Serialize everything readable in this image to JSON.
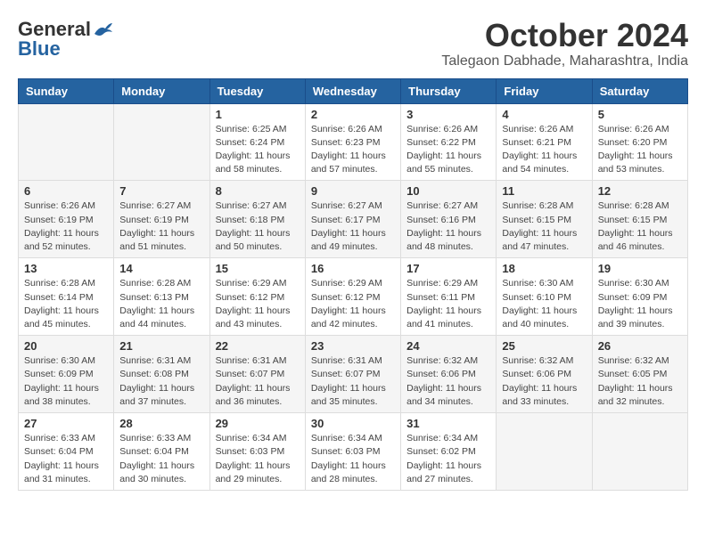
{
  "header": {
    "logo_general": "General",
    "logo_blue": "Blue",
    "month": "October 2024",
    "location": "Talegaon Dabhade, Maharashtra, India"
  },
  "days_of_week": [
    "Sunday",
    "Monday",
    "Tuesday",
    "Wednesday",
    "Thursday",
    "Friday",
    "Saturday"
  ],
  "weeks": [
    [
      {
        "day": "",
        "info": ""
      },
      {
        "day": "",
        "info": ""
      },
      {
        "day": "1",
        "info": "Sunrise: 6:25 AM\nSunset: 6:24 PM\nDaylight: 11 hours and 58 minutes."
      },
      {
        "day": "2",
        "info": "Sunrise: 6:26 AM\nSunset: 6:23 PM\nDaylight: 11 hours and 57 minutes."
      },
      {
        "day": "3",
        "info": "Sunrise: 6:26 AM\nSunset: 6:22 PM\nDaylight: 11 hours and 55 minutes."
      },
      {
        "day": "4",
        "info": "Sunrise: 6:26 AM\nSunset: 6:21 PM\nDaylight: 11 hours and 54 minutes."
      },
      {
        "day": "5",
        "info": "Sunrise: 6:26 AM\nSunset: 6:20 PM\nDaylight: 11 hours and 53 minutes."
      }
    ],
    [
      {
        "day": "6",
        "info": "Sunrise: 6:26 AM\nSunset: 6:19 PM\nDaylight: 11 hours and 52 minutes."
      },
      {
        "day": "7",
        "info": "Sunrise: 6:27 AM\nSunset: 6:19 PM\nDaylight: 11 hours and 51 minutes."
      },
      {
        "day": "8",
        "info": "Sunrise: 6:27 AM\nSunset: 6:18 PM\nDaylight: 11 hours and 50 minutes."
      },
      {
        "day": "9",
        "info": "Sunrise: 6:27 AM\nSunset: 6:17 PM\nDaylight: 11 hours and 49 minutes."
      },
      {
        "day": "10",
        "info": "Sunrise: 6:27 AM\nSunset: 6:16 PM\nDaylight: 11 hours and 48 minutes."
      },
      {
        "day": "11",
        "info": "Sunrise: 6:28 AM\nSunset: 6:15 PM\nDaylight: 11 hours and 47 minutes."
      },
      {
        "day": "12",
        "info": "Sunrise: 6:28 AM\nSunset: 6:15 PM\nDaylight: 11 hours and 46 minutes."
      }
    ],
    [
      {
        "day": "13",
        "info": "Sunrise: 6:28 AM\nSunset: 6:14 PM\nDaylight: 11 hours and 45 minutes."
      },
      {
        "day": "14",
        "info": "Sunrise: 6:28 AM\nSunset: 6:13 PM\nDaylight: 11 hours and 44 minutes."
      },
      {
        "day": "15",
        "info": "Sunrise: 6:29 AM\nSunset: 6:12 PM\nDaylight: 11 hours and 43 minutes."
      },
      {
        "day": "16",
        "info": "Sunrise: 6:29 AM\nSunset: 6:12 PM\nDaylight: 11 hours and 42 minutes."
      },
      {
        "day": "17",
        "info": "Sunrise: 6:29 AM\nSunset: 6:11 PM\nDaylight: 11 hours and 41 minutes."
      },
      {
        "day": "18",
        "info": "Sunrise: 6:30 AM\nSunset: 6:10 PM\nDaylight: 11 hours and 40 minutes."
      },
      {
        "day": "19",
        "info": "Sunrise: 6:30 AM\nSunset: 6:09 PM\nDaylight: 11 hours and 39 minutes."
      }
    ],
    [
      {
        "day": "20",
        "info": "Sunrise: 6:30 AM\nSunset: 6:09 PM\nDaylight: 11 hours and 38 minutes."
      },
      {
        "day": "21",
        "info": "Sunrise: 6:31 AM\nSunset: 6:08 PM\nDaylight: 11 hours and 37 minutes."
      },
      {
        "day": "22",
        "info": "Sunrise: 6:31 AM\nSunset: 6:07 PM\nDaylight: 11 hours and 36 minutes."
      },
      {
        "day": "23",
        "info": "Sunrise: 6:31 AM\nSunset: 6:07 PM\nDaylight: 11 hours and 35 minutes."
      },
      {
        "day": "24",
        "info": "Sunrise: 6:32 AM\nSunset: 6:06 PM\nDaylight: 11 hours and 34 minutes."
      },
      {
        "day": "25",
        "info": "Sunrise: 6:32 AM\nSunset: 6:06 PM\nDaylight: 11 hours and 33 minutes."
      },
      {
        "day": "26",
        "info": "Sunrise: 6:32 AM\nSunset: 6:05 PM\nDaylight: 11 hours and 32 minutes."
      }
    ],
    [
      {
        "day": "27",
        "info": "Sunrise: 6:33 AM\nSunset: 6:04 PM\nDaylight: 11 hours and 31 minutes."
      },
      {
        "day": "28",
        "info": "Sunrise: 6:33 AM\nSunset: 6:04 PM\nDaylight: 11 hours and 30 minutes."
      },
      {
        "day": "29",
        "info": "Sunrise: 6:34 AM\nSunset: 6:03 PM\nDaylight: 11 hours and 29 minutes."
      },
      {
        "day": "30",
        "info": "Sunrise: 6:34 AM\nSunset: 6:03 PM\nDaylight: 11 hours and 28 minutes."
      },
      {
        "day": "31",
        "info": "Sunrise: 6:34 AM\nSunset: 6:02 PM\nDaylight: 11 hours and 27 minutes."
      },
      {
        "day": "",
        "info": ""
      },
      {
        "day": "",
        "info": ""
      }
    ]
  ]
}
